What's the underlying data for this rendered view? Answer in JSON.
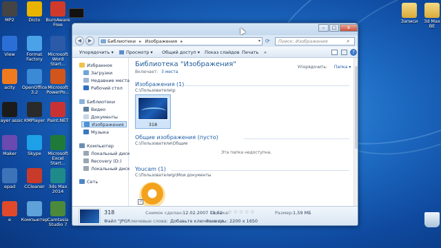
{
  "desktop": {
    "icons": [
      {
        "label": "MP2",
        "glyph": "media-file-icon",
        "color": "#444444"
      },
      {
        "label": "Dicto",
        "glyph": "dicto-app-icon",
        "color": "#e8b400"
      },
      {
        "label": "BurnAware Free",
        "glyph": "burnaware-icon",
        "color": "#d03a2a"
      },
      {
        "label": "View",
        "glyph": "viewer-icon",
        "color": "#2b6fd6"
      },
      {
        "label": "Format Factory",
        "glyph": "format-factory-icon",
        "color": "#4aa2e8"
      },
      {
        "label": "Microsoft Word Start...",
        "glyph": "word-icon",
        "color": "#2a5aa8"
      },
      {
        "label": "acity",
        "glyph": "audacity-icon",
        "color": "#f07a1e"
      },
      {
        "label": "OpenOffice 3.2",
        "glyph": "openoffice-icon",
        "color": "#3a8ad6"
      },
      {
        "label": "Microsoft PowerPo...",
        "glyph": "powerpoint-icon",
        "color": "#d2551c"
      },
      {
        "label": "Player assic",
        "glyph": "media-player-icon",
        "color": "#1b1b1b"
      },
      {
        "label": "KMPlayer",
        "glyph": "kmplayer-icon",
        "color": "#2a2a2a"
      },
      {
        "label": "Paint.NET",
        "glyph": "paintnet-icon",
        "color": "#c83232"
      },
      {
        "label": "Maker",
        "glyph": "movie-maker-icon",
        "color": "#6a4ab0"
      },
      {
        "label": "Skype",
        "glyph": "skype-icon",
        "color": "#1ea0e8"
      },
      {
        "label": "Microsoft Excel Start...",
        "glyph": "excel-icon",
        "color": "#1f7a3a"
      },
      {
        "label": "epad",
        "glyph": "notepad-icon",
        "color": "#3d73b8"
      },
      {
        "label": "CCleaner",
        "glyph": "ccleaner-icon",
        "color": "#c83a2a"
      },
      {
        "label": "3ds Max 2014",
        "glyph": "3dsmax-icon",
        "color": "#1e8a8a"
      },
      {
        "label": "e",
        "glyph": "chrome-icon",
        "color": "#e04a2a"
      },
      {
        "label": "Компьютер",
        "glyph": "computer-icon",
        "color": "#5fa2da"
      },
      {
        "label": "Camtasia Studio 7",
        "glyph": "camtasia-icon",
        "color": "#4a8a3a"
      }
    ],
    "right_icons": [
      {
        "label": "Записи",
        "glyph": "folder-icon",
        "color": "#e8c25a"
      },
      {
        "label": "3d Max ВЕ",
        "glyph": "folder-icon",
        "color": "#e8c25a"
      }
    ],
    "bottom_right_icon": {
      "glyph": "recycle-bin-icon",
      "color": "#d7e6f2"
    }
  },
  "explorer": {
    "title_buttons": {
      "minimize": "–",
      "maximize": "□",
      "close": "x"
    },
    "nav_back": "◀",
    "nav_forward": "▶",
    "address": {
      "seg1": "Библиотеки",
      "seg2": "Изображения",
      "sep": "▸"
    },
    "search_placeholder": "Поиск: Изображения",
    "toolbar": {
      "organize": "Упорядочить ▾",
      "view": "Просмотр ▾",
      "share": "Общий доступ ▾",
      "slideshow": "Показ слайдов",
      "print": "Печать",
      "more": "»"
    },
    "nav": {
      "favorites": "Избранное",
      "downloads": "Загрузки",
      "recent": "Недавние места",
      "desktop": "Рабочий стол",
      "libraries": "Библиотеки",
      "videos": "Видео",
      "documents": "Документы",
      "images": "Изображения",
      "music": "Музыка",
      "computer": "Компьютер",
      "local_c": "Локальный диск (C",
      "recovery": "Recovery (D:)",
      "local_g": "Локальный диск (G",
      "network": "Сеть"
    },
    "library": {
      "title": "Библиотека \"Изображения\"",
      "includes_label": "Включает:",
      "includes_value": "3 места",
      "arrange_label": "Упорядочить:",
      "arrange_value": "Папка ▾"
    },
    "sections": [
      {
        "title": "Изображения (1)",
        "path": "C:\\Пользователи\\р"
      },
      {
        "title": "Общие изображения (пусто)",
        "path": "C:\\Пользователи\\Общие",
        "empty_text": "Эта папка недоступна."
      },
      {
        "title": "Youcam (1)",
        "path": "C:\\Пользователи\\р\\Мои документы"
      }
    ],
    "thumb_label": "318",
    "details": {
      "name": "318",
      "date_label": "Снимок сделан:",
      "date_value": "12.02.2007 19:52",
      "rating_label": "Оценка:",
      "stars": "☆☆☆☆☆",
      "size_label": "Размер:",
      "size_value": "1,59 МБ",
      "type": "Файл \"JPG\"",
      "keywords_label": "Ключевые слова:",
      "keywords_value": "Добавьте ключевое сл...",
      "dims_label": "Размеры:",
      "dims_value": "2200 x 1650"
    }
  }
}
